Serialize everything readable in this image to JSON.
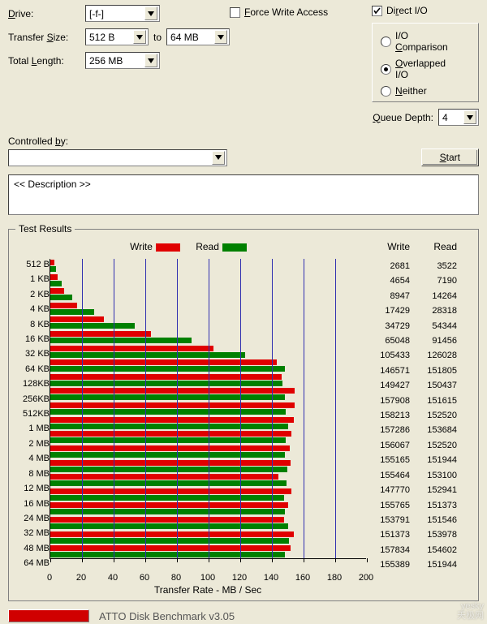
{
  "labels": {
    "drive": "Drive:",
    "transfer_size": "Transfer Size:",
    "to": "to",
    "total_length": "Total Length:",
    "force_write": "Force Write Access",
    "direct_io": "Direct I/O",
    "io_comparison": "I/O Comparison",
    "overlapped_io": "Overlapped I/O",
    "neither": "Neither",
    "queue_depth": "Queue Depth:",
    "controlled_by": "Controlled by:",
    "start_btn": "Start",
    "description": "<< Description >>",
    "results_title": "Test Results",
    "write": "Write",
    "read": "Read",
    "xaxis": "Transfer Rate - MB / Sec",
    "footer": "ATTO Disk Benchmark v3.05",
    "watermark": "yesky"
  },
  "settings": {
    "drive_value": "[-f-]",
    "size_from": "512 B",
    "size_to": "64 MB",
    "total_length": "256 MB",
    "force_write_checked": false,
    "direct_io_checked": true,
    "io_mode": "overlapped",
    "queue_depth": "4",
    "controlled_by": ""
  },
  "chart_data": {
    "type": "bar",
    "orientation": "horizontal",
    "title": "Test Results",
    "xlabel": "Transfer Rate - MB / Sec",
    "ylabel": "",
    "xlim": [
      0,
      200
    ],
    "xticks": [
      0,
      20,
      40,
      60,
      80,
      100,
      120,
      140,
      160,
      180,
      200
    ],
    "categories": [
      "512 B",
      "1 KB",
      "2 KB",
      "4 KB",
      "8 KB",
      "16 KB",
      "32 KB",
      "64 KB",
      "128KB",
      "256KB",
      "512KB",
      "1 MB",
      "2 MB",
      "4 MB",
      "8 MB",
      "12 MB",
      "16 MB",
      "24 MB",
      "32 MB",
      "48 MB",
      "64 MB"
    ],
    "series": [
      {
        "name": "Write",
        "color": "#e00000",
        "values_kb_s": [
          2681,
          4654,
          8947,
          17429,
          34729,
          65048,
          105433,
          146571,
          149427,
          157908,
          158213,
          157286,
          156067,
          155165,
          155464,
          147770,
          155765,
          153791,
          151373,
          157834,
          155389
        ],
        "values_mb_s": [
          2.6,
          4.5,
          8.7,
          17.0,
          33.9,
          63.5,
          103.0,
          143.1,
          145.9,
          154.2,
          154.5,
          153.6,
          152.4,
          151.5,
          151.8,
          144.3,
          152.1,
          150.2,
          147.8,
          154.1,
          151.7
        ]
      },
      {
        "name": "Read",
        "color": "#008000",
        "values_kb_s": [
          3522,
          7190,
          14264,
          28318,
          54344,
          91456,
          126028,
          151805,
          150437,
          151615,
          152520,
          153684,
          152520,
          151944,
          153100,
          152941,
          151373,
          151546,
          153978,
          154602,
          151944
        ],
        "values_mb_s": [
          3.4,
          7.0,
          13.9,
          27.7,
          53.1,
          89.3,
          123.1,
          148.2,
          146.9,
          148.1,
          148.9,
          150.1,
          148.9,
          148.4,
          149.5,
          149.4,
          147.8,
          148.0,
          150.4,
          151.0,
          148.4
        ]
      }
    ]
  }
}
